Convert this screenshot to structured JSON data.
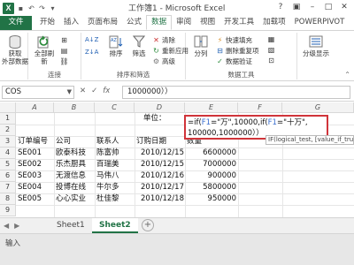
{
  "titlebar": {
    "app_icon": "X",
    "title": "工作簿1 - Microsoft Excel",
    "minimize": "?",
    "restore": "□",
    "close": "✕",
    "qat": [
      "save-icon",
      "undo-icon",
      "redo-icon",
      "customize-icon"
    ]
  },
  "menu": {
    "tabs": [
      "文件",
      "开始",
      "插入",
      "页面布局",
      "公式",
      "数据",
      "审阅",
      "视图",
      "开发工具",
      "加载项",
      "POWERPIVOT"
    ],
    "active_tab": "数据"
  },
  "ribbon": {
    "get_external": "获取\n外部数据",
    "refresh_all": "全部刷新",
    "group_connections": "连接",
    "sort_az": "A↓Z",
    "sort_za": "Z↓A",
    "sort": "排序",
    "filter": "筛选",
    "clear": "清除",
    "reapply": "重新应用",
    "advanced": "高级",
    "group_sort_filter": "排序和筛选",
    "text_to_columns": "分列",
    "flash_fill": "快速填充",
    "remove_duplicates": "删除重复项",
    "data_validation": "数据验证",
    "group_data_tools": "数据工具",
    "outline": "分级显示"
  },
  "formula_bar": {
    "name_box": "COS",
    "formula": "1000000））"
  },
  "grid": {
    "columns": [
      "A",
      "B",
      "C",
      "D",
      "E",
      "F",
      "G"
    ],
    "rows": [
      "1",
      "2",
      "3",
      "4",
      "5",
      "6",
      "7",
      "8",
      "9",
      "10"
    ],
    "label_unit": "单位：",
    "headers": [
      "订单编号",
      "公司",
      "联系人",
      "订购日期",
      "数量"
    ],
    "data": [
      [
        "SE001",
        "欧泰科技",
        "陈富帅",
        "2010/12/15",
        "6600000"
      ],
      [
        "SE002",
        "乐杰厨具",
        "百瑞美",
        "2010/12/15",
        "7000000"
      ],
      [
        "SE003",
        "无渡信息",
        "马伟八",
        "2010/12/16",
        "900000"
      ],
      [
        "SE004",
        "投博在线",
        "牛尔多",
        "2010/12/17",
        "5800000"
      ],
      [
        "SE005",
        "心心实业",
        "杜佳黎",
        "2010/12/18",
        "950000"
      ]
    ]
  },
  "edit_cell": {
    "line1_prefix": "=if(",
    "line1_ref1": "F1",
    "line1_mid": "=\"万\",10000,if(",
    "line1_ref2": "F1",
    "line1_end": "=\"十万\",",
    "line2": "100000,1000000））"
  },
  "tooltip": "IF(logical_test, [value_if_true]",
  "sheets": [
    "Sheet1",
    "Sheet2"
  ],
  "active_sheet": "Sheet2",
  "status": "输入"
}
